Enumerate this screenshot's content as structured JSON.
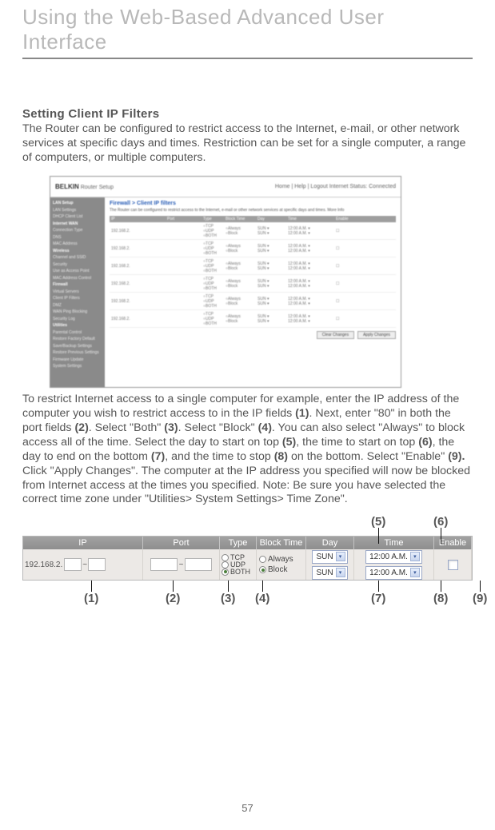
{
  "page_title": "Using the Web-Based Advanced User Interface",
  "section_heading": "Setting Client IP Filters",
  "intro_text": "The Router can be configured to restrict access to the Internet, e-mail, or other network services at specific days and times. Restriction can be set for a single computer, a range of computers, or multiple computers.",
  "screenshot": {
    "brand": "BELKIN",
    "header_right": "Home | Help | Logout    Internet Status: Connected",
    "title_bar": "Router Setup",
    "panel_title": "Firewall > Client IP filters",
    "panel_desc": "The Router can be configured to restrict access to the Internet, e-mail or other network services at specific days and times. More Info",
    "sidebar": [
      "LAN Setup",
      "LAN Settings",
      "DHCP Client List",
      "Internet WAN",
      "Connection Type",
      "DNS",
      "MAC Address",
      "Wireless",
      "Channel and SSID",
      "Security",
      "Use as Access Point",
      "MAC Address Control",
      "Firewall",
      "Virtual Servers",
      "Client IP Filters",
      "DMZ",
      "WAN Ping Blocking",
      "Security Log",
      "Utilities",
      "Parental Control",
      "Restore Factory Default",
      "Save/Backup Settings",
      "Restore Previous Settings",
      "Firmware Update",
      "System Settings"
    ],
    "table_headers": [
      "IP",
      "Port",
      "Type",
      "Block Time",
      "Day",
      "Time",
      "Enable"
    ],
    "row_sample": {
      "ip": "192.168.2.",
      "types": [
        "TCP",
        "UDP",
        "BOTH"
      ],
      "block_opts": [
        "Always",
        "Block"
      ],
      "day": "SUN",
      "time": "12:00 A.M."
    },
    "buttons": [
      "Clear Changes",
      "Apply Changes"
    ]
  },
  "instructions_parts": {
    "p0": "To restrict Internet access to a single computer for example, enter the IP address of the computer you wish to restrict access to in the IP fields ",
    "b1": "(1)",
    "p1": ". Next, enter \"80\" in both the port fields ",
    "b2": "(2)",
    "p2": ". Select \"Both\" ",
    "b3": "(3)",
    "p3": ". Select \"Block\" ",
    "b4": "(4)",
    "p4": ". You can also select \"Always\" to block access all of the time. Select the day to start on top ",
    "b5": "(5)",
    "p5": ", the time to start on top ",
    "b6": "(6)",
    "p6": ", the day to end on the bottom ",
    "b7": "(7)",
    "p7": ", and the time to stop ",
    "b8": "(8)",
    "p8": " on the bottom. Select \"Enable\" ",
    "b9": "(9).",
    "p9": " Click \"Apply Changes\". The computer at the IP address you specified will now be blocked from Internet access at the times you specified. Note: Be sure you have selected the correct time zone under \"Utilities> System Settings> Time Zone\"."
  },
  "callouts_top": {
    "c5": "(5)",
    "c6": "(6)"
  },
  "filter_row": {
    "headers": {
      "ip": "IP",
      "port": "Port",
      "type": "Type",
      "block": "Block Time",
      "day": "Day",
      "time": "Time",
      "enable": "Enable"
    },
    "ip_prefix": "192.168.2.",
    "tilde": "~",
    "type_opts": {
      "tcp": "TCP",
      "udp": "UDP",
      "both": "BOTH"
    },
    "block_opts": {
      "always": "Always",
      "block": "Block"
    },
    "day": "SUN",
    "time": "12:00 A.M."
  },
  "callouts_bottom": {
    "c1": "(1)",
    "c2": "(2)",
    "c3": "(3)",
    "c4": "(4)",
    "c7": "(7)",
    "c8": "(8)",
    "c9": "(9)"
  },
  "page_number": "57"
}
